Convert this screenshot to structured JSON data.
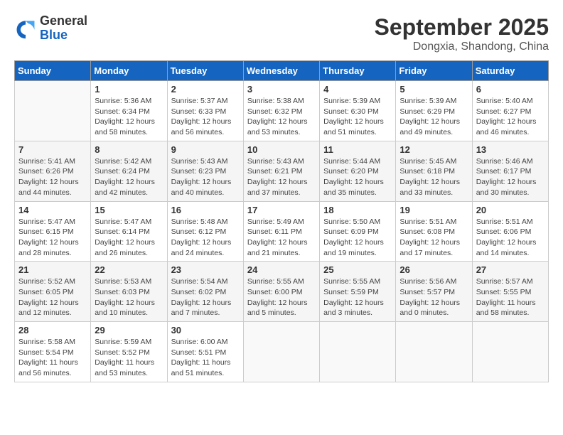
{
  "header": {
    "logo": {
      "general": "General",
      "blue": "Blue"
    },
    "title": "September 2025",
    "location": "Dongxia, Shandong, China"
  },
  "weekdays": [
    "Sunday",
    "Monday",
    "Tuesday",
    "Wednesday",
    "Thursday",
    "Friday",
    "Saturday"
  ],
  "weeks": [
    [
      {
        "day": null,
        "info": null
      },
      {
        "day": "1",
        "sunrise": "Sunrise: 5:36 AM",
        "sunset": "Sunset: 6:34 PM",
        "daylight": "Daylight: 12 hours and 58 minutes."
      },
      {
        "day": "2",
        "sunrise": "Sunrise: 5:37 AM",
        "sunset": "Sunset: 6:33 PM",
        "daylight": "Daylight: 12 hours and 56 minutes."
      },
      {
        "day": "3",
        "sunrise": "Sunrise: 5:38 AM",
        "sunset": "Sunset: 6:32 PM",
        "daylight": "Daylight: 12 hours and 53 minutes."
      },
      {
        "day": "4",
        "sunrise": "Sunrise: 5:39 AM",
        "sunset": "Sunset: 6:30 PM",
        "daylight": "Daylight: 12 hours and 51 minutes."
      },
      {
        "day": "5",
        "sunrise": "Sunrise: 5:39 AM",
        "sunset": "Sunset: 6:29 PM",
        "daylight": "Daylight: 12 hours and 49 minutes."
      },
      {
        "day": "6",
        "sunrise": "Sunrise: 5:40 AM",
        "sunset": "Sunset: 6:27 PM",
        "daylight": "Daylight: 12 hours and 46 minutes."
      }
    ],
    [
      {
        "day": "7",
        "sunrise": "Sunrise: 5:41 AM",
        "sunset": "Sunset: 6:26 PM",
        "daylight": "Daylight: 12 hours and 44 minutes."
      },
      {
        "day": "8",
        "sunrise": "Sunrise: 5:42 AM",
        "sunset": "Sunset: 6:24 PM",
        "daylight": "Daylight: 12 hours and 42 minutes."
      },
      {
        "day": "9",
        "sunrise": "Sunrise: 5:43 AM",
        "sunset": "Sunset: 6:23 PM",
        "daylight": "Daylight: 12 hours and 40 minutes."
      },
      {
        "day": "10",
        "sunrise": "Sunrise: 5:43 AM",
        "sunset": "Sunset: 6:21 PM",
        "daylight": "Daylight: 12 hours and 37 minutes."
      },
      {
        "day": "11",
        "sunrise": "Sunrise: 5:44 AM",
        "sunset": "Sunset: 6:20 PM",
        "daylight": "Daylight: 12 hours and 35 minutes."
      },
      {
        "day": "12",
        "sunrise": "Sunrise: 5:45 AM",
        "sunset": "Sunset: 6:18 PM",
        "daylight": "Daylight: 12 hours and 33 minutes."
      },
      {
        "day": "13",
        "sunrise": "Sunrise: 5:46 AM",
        "sunset": "Sunset: 6:17 PM",
        "daylight": "Daylight: 12 hours and 30 minutes."
      }
    ],
    [
      {
        "day": "14",
        "sunrise": "Sunrise: 5:47 AM",
        "sunset": "Sunset: 6:15 PM",
        "daylight": "Daylight: 12 hours and 28 minutes."
      },
      {
        "day": "15",
        "sunrise": "Sunrise: 5:47 AM",
        "sunset": "Sunset: 6:14 PM",
        "daylight": "Daylight: 12 hours and 26 minutes."
      },
      {
        "day": "16",
        "sunrise": "Sunrise: 5:48 AM",
        "sunset": "Sunset: 6:12 PM",
        "daylight": "Daylight: 12 hours and 24 minutes."
      },
      {
        "day": "17",
        "sunrise": "Sunrise: 5:49 AM",
        "sunset": "Sunset: 6:11 PM",
        "daylight": "Daylight: 12 hours and 21 minutes."
      },
      {
        "day": "18",
        "sunrise": "Sunrise: 5:50 AM",
        "sunset": "Sunset: 6:09 PM",
        "daylight": "Daylight: 12 hours and 19 minutes."
      },
      {
        "day": "19",
        "sunrise": "Sunrise: 5:51 AM",
        "sunset": "Sunset: 6:08 PM",
        "daylight": "Daylight: 12 hours and 17 minutes."
      },
      {
        "day": "20",
        "sunrise": "Sunrise: 5:51 AM",
        "sunset": "Sunset: 6:06 PM",
        "daylight": "Daylight: 12 hours and 14 minutes."
      }
    ],
    [
      {
        "day": "21",
        "sunrise": "Sunrise: 5:52 AM",
        "sunset": "Sunset: 6:05 PM",
        "daylight": "Daylight: 12 hours and 12 minutes."
      },
      {
        "day": "22",
        "sunrise": "Sunrise: 5:53 AM",
        "sunset": "Sunset: 6:03 PM",
        "daylight": "Daylight: 12 hours and 10 minutes."
      },
      {
        "day": "23",
        "sunrise": "Sunrise: 5:54 AM",
        "sunset": "Sunset: 6:02 PM",
        "daylight": "Daylight: 12 hours and 7 minutes."
      },
      {
        "day": "24",
        "sunrise": "Sunrise: 5:55 AM",
        "sunset": "Sunset: 6:00 PM",
        "daylight": "Daylight: 12 hours and 5 minutes."
      },
      {
        "day": "25",
        "sunrise": "Sunrise: 5:55 AM",
        "sunset": "Sunset: 5:59 PM",
        "daylight": "Daylight: 12 hours and 3 minutes."
      },
      {
        "day": "26",
        "sunrise": "Sunrise: 5:56 AM",
        "sunset": "Sunset: 5:57 PM",
        "daylight": "Daylight: 12 hours and 0 minutes."
      },
      {
        "day": "27",
        "sunrise": "Sunrise: 5:57 AM",
        "sunset": "Sunset: 5:55 PM",
        "daylight": "Daylight: 11 hours and 58 minutes."
      }
    ],
    [
      {
        "day": "28",
        "sunrise": "Sunrise: 5:58 AM",
        "sunset": "Sunset: 5:54 PM",
        "daylight": "Daylight: 11 hours and 56 minutes."
      },
      {
        "day": "29",
        "sunrise": "Sunrise: 5:59 AM",
        "sunset": "Sunset: 5:52 PM",
        "daylight": "Daylight: 11 hours and 53 minutes."
      },
      {
        "day": "30",
        "sunrise": "Sunrise: 6:00 AM",
        "sunset": "Sunset: 5:51 PM",
        "daylight": "Daylight: 11 hours and 51 minutes."
      },
      {
        "day": null,
        "info": null
      },
      {
        "day": null,
        "info": null
      },
      {
        "day": null,
        "info": null
      },
      {
        "day": null,
        "info": null
      }
    ]
  ]
}
